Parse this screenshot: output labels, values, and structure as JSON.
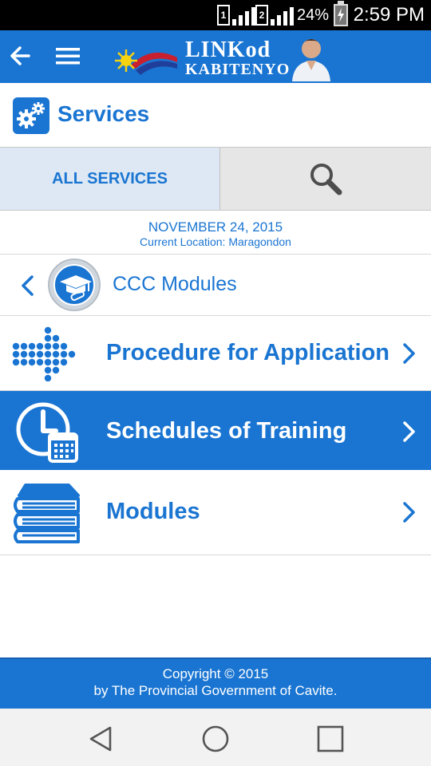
{
  "status_bar": {
    "sim1": "1",
    "sim2": "2",
    "battery_percent": "24%",
    "time": "2:59 PM"
  },
  "app_bar": {
    "logo_line1": "LINKod",
    "logo_line2": "KABITENYO"
  },
  "page": {
    "title": "Services"
  },
  "tabs": {
    "all_services": "ALL SERVICES"
  },
  "info": {
    "date": "NOVEMBER 24, 2015",
    "location": "Current Location: Maragondon"
  },
  "module": {
    "title": "CCC Modules"
  },
  "items": [
    {
      "label": "Procedure for Application"
    },
    {
      "label": "Schedules of Training",
      "selected": true
    },
    {
      "label": "Modules"
    }
  ],
  "footer": {
    "line1": "Copyright © 2015",
    "line2": "by The Provincial Government of Cavite."
  },
  "colors": {
    "primary": "#1a75d2",
    "tab_active_bg": "#dde8f4",
    "tab_bg": "#e6e6e6"
  }
}
